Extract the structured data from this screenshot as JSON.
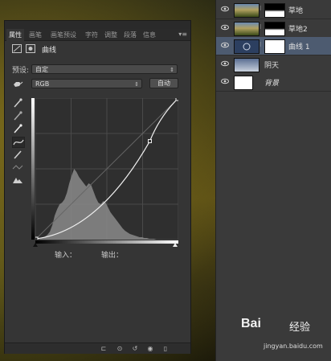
{
  "layers": [
    {
      "name": "草地",
      "italic": false,
      "selected": false,
      "thumb": "grass-thumb",
      "mask": true
    },
    {
      "name": "草地2",
      "italic": false,
      "selected": false,
      "thumb": "grass-thumb",
      "mask": true
    },
    {
      "name": "曲线 1",
      "italic": false,
      "selected": true,
      "thumb": "curves-thumb",
      "mask": true
    },
    {
      "name": "阴天",
      "italic": false,
      "selected": false,
      "thumb": "sky-thumb",
      "mask": false
    },
    {
      "name": "背景",
      "italic": true,
      "selected": false,
      "thumb": "white-thumb",
      "mask": false
    }
  ],
  "properties": {
    "tabs": [
      "属性",
      "画笔",
      "画笔预设",
      "字符",
      "调整",
      "段落",
      "信息"
    ],
    "active_tab": "属性",
    "title": "曲线",
    "preset_label": "预设:",
    "preset_value": "自定",
    "channel_value": "RGB",
    "auto_button": "自动",
    "input_label": "输入：",
    "output_label": "输出："
  },
  "curve": {
    "points": [
      [
        0,
        0
      ],
      [
        205,
        178
      ],
      [
        255,
        255
      ]
    ],
    "range": [
      0,
      255
    ]
  },
  "watermark": {
    "logo": "Bai",
    "logo_tail": "经验",
    "url": "jingyan.baidu.com"
  },
  "colors": {
    "selected_layer": "#4d5b70",
    "panel": "#353535"
  }
}
